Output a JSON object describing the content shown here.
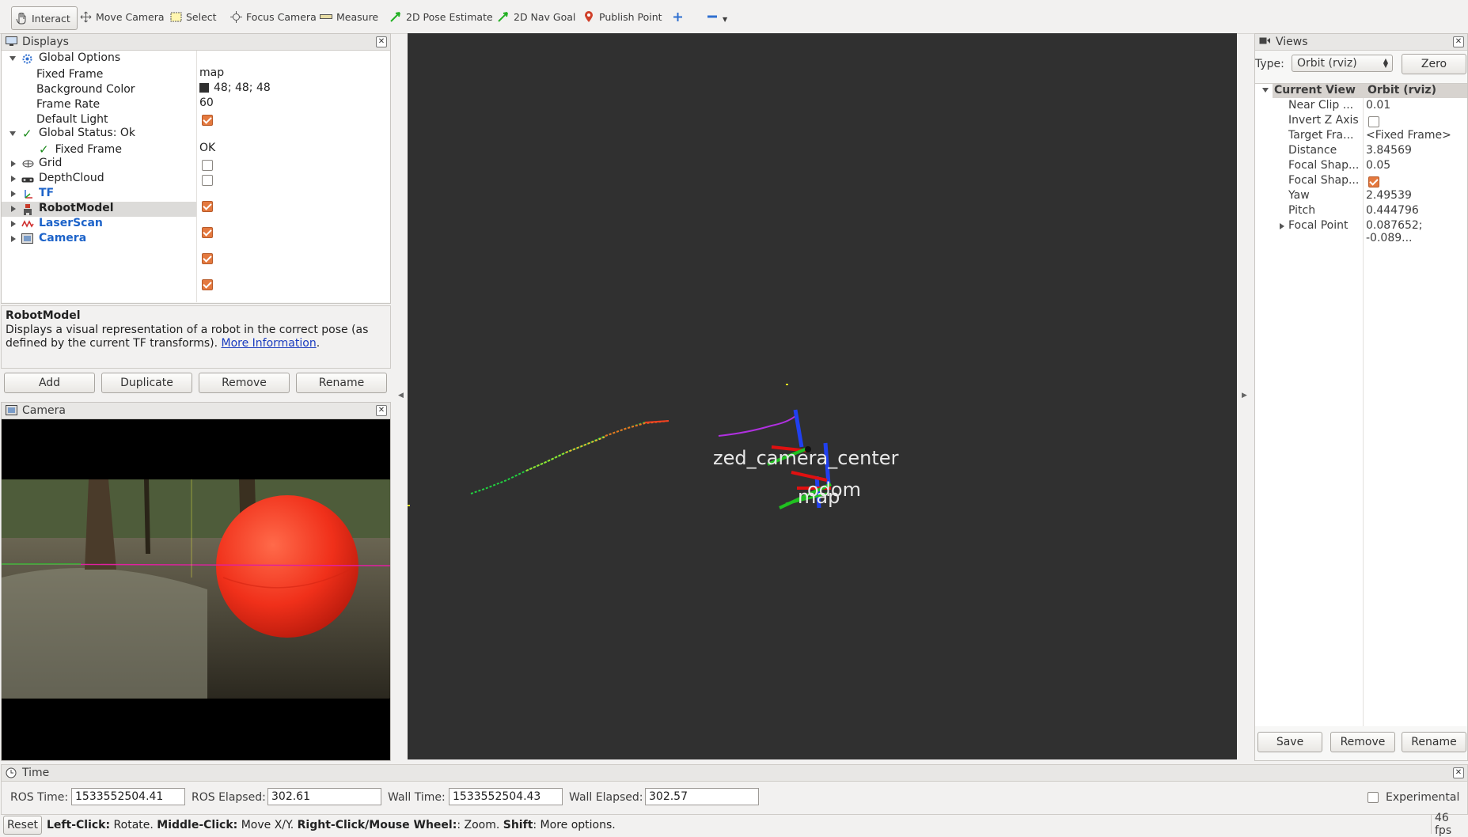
{
  "toolbar": {
    "tools": [
      {
        "label": "Interact",
        "icon": "hand-icon"
      },
      {
        "label": "Move Camera",
        "icon": "move-camera-icon"
      },
      {
        "label": "Select",
        "icon": "select-icon"
      },
      {
        "label": "Focus Camera",
        "icon": "focus-camera-icon"
      },
      {
        "label": "Measure",
        "icon": "ruler-icon"
      },
      {
        "label": "2D Pose Estimate",
        "icon": "green-arrow-icon"
      },
      {
        "label": "2D Nav Goal",
        "icon": "green-arrow-icon"
      },
      {
        "label": "Publish Point",
        "icon": "map-pin-icon"
      }
    ],
    "add_icon": "plus-icon",
    "remove_icon": "minus-icon"
  },
  "displays": {
    "title": "Displays",
    "global_options": {
      "label": "Global Options",
      "fixed_frame_label": "Fixed Frame",
      "fixed_frame_value": "map",
      "bg_color_label": "Background Color",
      "bg_color_value": "48; 48; 48",
      "bg_color_swatch": "#303030",
      "frame_rate_label": "Frame Rate",
      "frame_rate_value": "60",
      "default_light_label": "Default Light"
    },
    "global_status": {
      "label": "Global Status: Ok",
      "fixed_frame_label": "Fixed Frame",
      "fixed_frame_value": "OK"
    },
    "items": [
      {
        "label": "Grid",
        "checked": false
      },
      {
        "label": "DepthCloud",
        "checked": false
      },
      {
        "label": "TF",
        "checked": true
      },
      {
        "label": "RobotModel",
        "checked": true
      },
      {
        "label": "LaserScan",
        "checked": true
      },
      {
        "label": "Camera",
        "checked": true
      }
    ],
    "description_title": "RobotModel",
    "description_text": "Displays a visual representation of a robot in the correct pose (as defined by the current TF transforms).",
    "description_link": "More Information",
    "description_end": ".",
    "buttons": {
      "add": "Add",
      "duplicate": "Duplicate",
      "remove": "Remove",
      "rename": "Rename"
    }
  },
  "camera_panel": {
    "title": "Camera"
  },
  "viewport": {
    "labels": {
      "camera_center": "zed_camera_center",
      "odom": "odom",
      "map": "map"
    }
  },
  "views": {
    "title": "Views",
    "type_label": "Type:",
    "type_value": "Orbit (rviz)",
    "zero_button": "Zero",
    "header": {
      "name": "Current View",
      "value": "Orbit (rviz)"
    },
    "props": [
      {
        "name": "Near Clip ...",
        "value": "0.01"
      },
      {
        "name": "Invert Z Axis",
        "value": ""
      },
      {
        "name": "Target Fra...",
        "value": "<Fixed Frame>"
      },
      {
        "name": "Distance",
        "value": "3.84569"
      },
      {
        "name": "Focal Shap...",
        "value": "0.05"
      },
      {
        "name": "Focal Shap...",
        "value": ""
      },
      {
        "name": "Yaw",
        "value": "2.49539"
      },
      {
        "name": "Pitch",
        "value": "0.444796"
      },
      {
        "name": "Focal Point",
        "value": "0.087652; -0.089..."
      }
    ],
    "buttons": {
      "save": "Save",
      "remove": "Remove",
      "rename": "Rename"
    }
  },
  "time": {
    "title": "Time",
    "ros_time_label": "ROS Time:",
    "ros_time_value": "1533552504.41",
    "ros_elapsed_label": "ROS Elapsed:",
    "ros_elapsed_value": "302.61",
    "wall_time_label": "Wall Time:",
    "wall_time_value": "1533552504.43",
    "wall_elapsed_label": "Wall Elapsed:",
    "wall_elapsed_value": "302.57",
    "experimental_label": "Experimental"
  },
  "statusbar": {
    "reset": "Reset",
    "left_click": "Left-Click:",
    "left_click_desc": " Rotate. ",
    "middle_click": "Middle-Click:",
    "middle_click_desc": " Move X/Y. ",
    "right_click": "Right-Click/Mouse Wheel:",
    "right_click_desc": ": Zoom. ",
    "shift": "Shift",
    "shift_desc": ": More options.",
    "fps": "46 fps"
  }
}
